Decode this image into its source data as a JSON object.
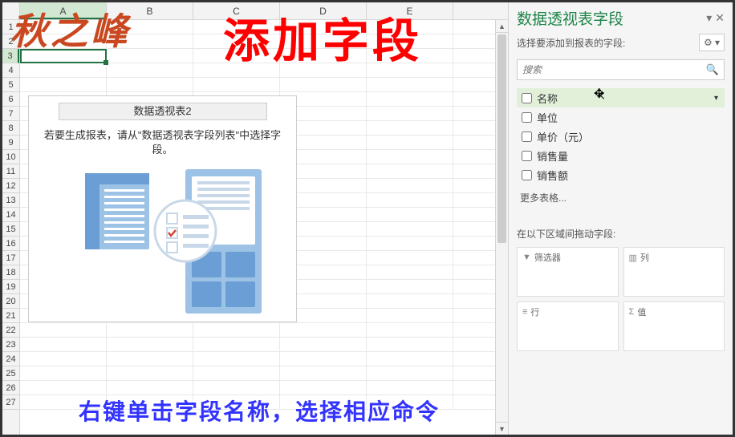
{
  "watermark": "秋之峰",
  "overlay_title": "添加字段",
  "overlay_tip": "右键单击字段名称，选择相应命令",
  "sheet": {
    "columns": [
      "A",
      "B",
      "C",
      "D",
      "E"
    ],
    "rows": [
      1,
      2,
      3,
      4,
      5,
      6,
      7,
      8,
      9,
      10,
      11,
      12,
      13,
      14,
      15,
      16,
      17,
      18,
      19,
      20,
      21,
      22,
      23,
      24,
      25,
      26,
      27
    ],
    "active_cell": "A3",
    "placeholder": {
      "title": "数据透视表2",
      "message": "若要生成报表，请从\"数据透视表字段列表\"中选择字段。"
    }
  },
  "pane": {
    "title": "数据透视表字段",
    "subtitle": "选择要添加到报表的字段:",
    "search_placeholder": "搜索",
    "fields": [
      {
        "label": "名称",
        "highlighted": true,
        "dropdown": true
      },
      {
        "label": "单位"
      },
      {
        "label": "单价（元）"
      },
      {
        "label": "销售量"
      },
      {
        "label": "销售额"
      }
    ],
    "more_tables": "更多表格...",
    "areas_label": "在以下区域间拖动字段:",
    "areas": {
      "filter": "筛选器",
      "columns": "列",
      "rows": "行",
      "values": "值"
    }
  }
}
